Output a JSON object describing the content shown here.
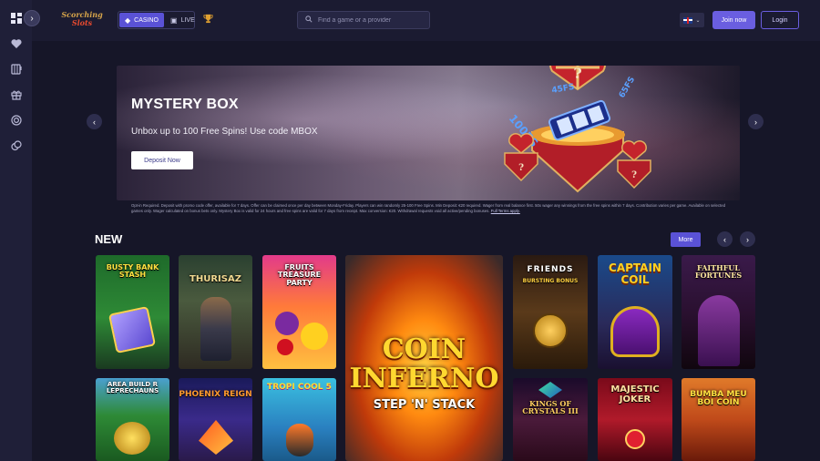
{
  "header": {
    "logo_line1": "Scorching",
    "logo_line2": "Slots",
    "tabs": [
      {
        "label": "CASINO",
        "active": true
      },
      {
        "label": "LIVE",
        "active": false
      }
    ],
    "search_placeholder": "Find a game or a provider",
    "join_label": "Join now",
    "login_label": "Login"
  },
  "sidebar": {
    "icons": [
      "dashboard-icon",
      "heart-icon",
      "slots-icon",
      "gift-icon",
      "target-icon",
      "chips-icon"
    ]
  },
  "banner": {
    "title": "MYSTERY BOX",
    "subtitle": "Unbox up to 100 Free Spins! Use code MBOX",
    "cta_label": "Deposit Now",
    "terms": "Opt-in Required. Deposit with promo code offer, available for 7 days. Offer can be claimed once per day between Monday-Friday. Players can win randomly 25-100 Free Spins. Min Deposit: €20 required. Wager from real balance first. 50x wager any winnings from the free spins within 7 days. Contribution varies per game. Available on selected games only. Wager calculated on bonus bets only. Mystery Box is valid for 24 hours and free spins are valid for 7 days from receipt. Max conversion: €20. Withdrawal requests void all active/pending bonuses.",
    "terms_link": "Full Terms apply."
  },
  "section": {
    "title": "NEW",
    "more_label": "More"
  },
  "games": [
    {
      "name": "Busty Bank Stash",
      "title": "BUSTY BANK STASH"
    },
    {
      "name": "Thurisaz",
      "title": "THURISAZ"
    },
    {
      "name": "Fruits Treasure Party",
      "title": "FRUITS TREASURE PARTY"
    },
    {
      "name": "Coin Inferno Step 'n' Stack",
      "title": "COIN INFERNO",
      "subtitle": "STEP 'N' STACK"
    },
    {
      "name": "Friends Bursting Bonus",
      "title": "FRIENDS",
      "subtitle": "BURSTING BONUS"
    },
    {
      "name": "Captain Coil",
      "title": "CAPTAIN COIL"
    },
    {
      "name": "Faithful Fortunes",
      "title": "FAITHFUL FORTUNES"
    },
    {
      "name": "Area Build R Leprechauns",
      "title": "AREA BUILD R LEPRECHAUNS"
    },
    {
      "name": "Phoenix Reign",
      "title": "PHOENIX REIGN"
    },
    {
      "name": "Tropicool 5",
      "title": "TROPI COOL 5"
    },
    {
      "name": "Kings of Crystals III",
      "title": "KINGS OF CRYSTALS III"
    },
    {
      "name": "Majestic Joker",
      "title": "MAJESTIC JOKER"
    },
    {
      "name": "Bumba Meu Boi Coin",
      "title": "BUMBA MEU BOI COIN"
    }
  ]
}
